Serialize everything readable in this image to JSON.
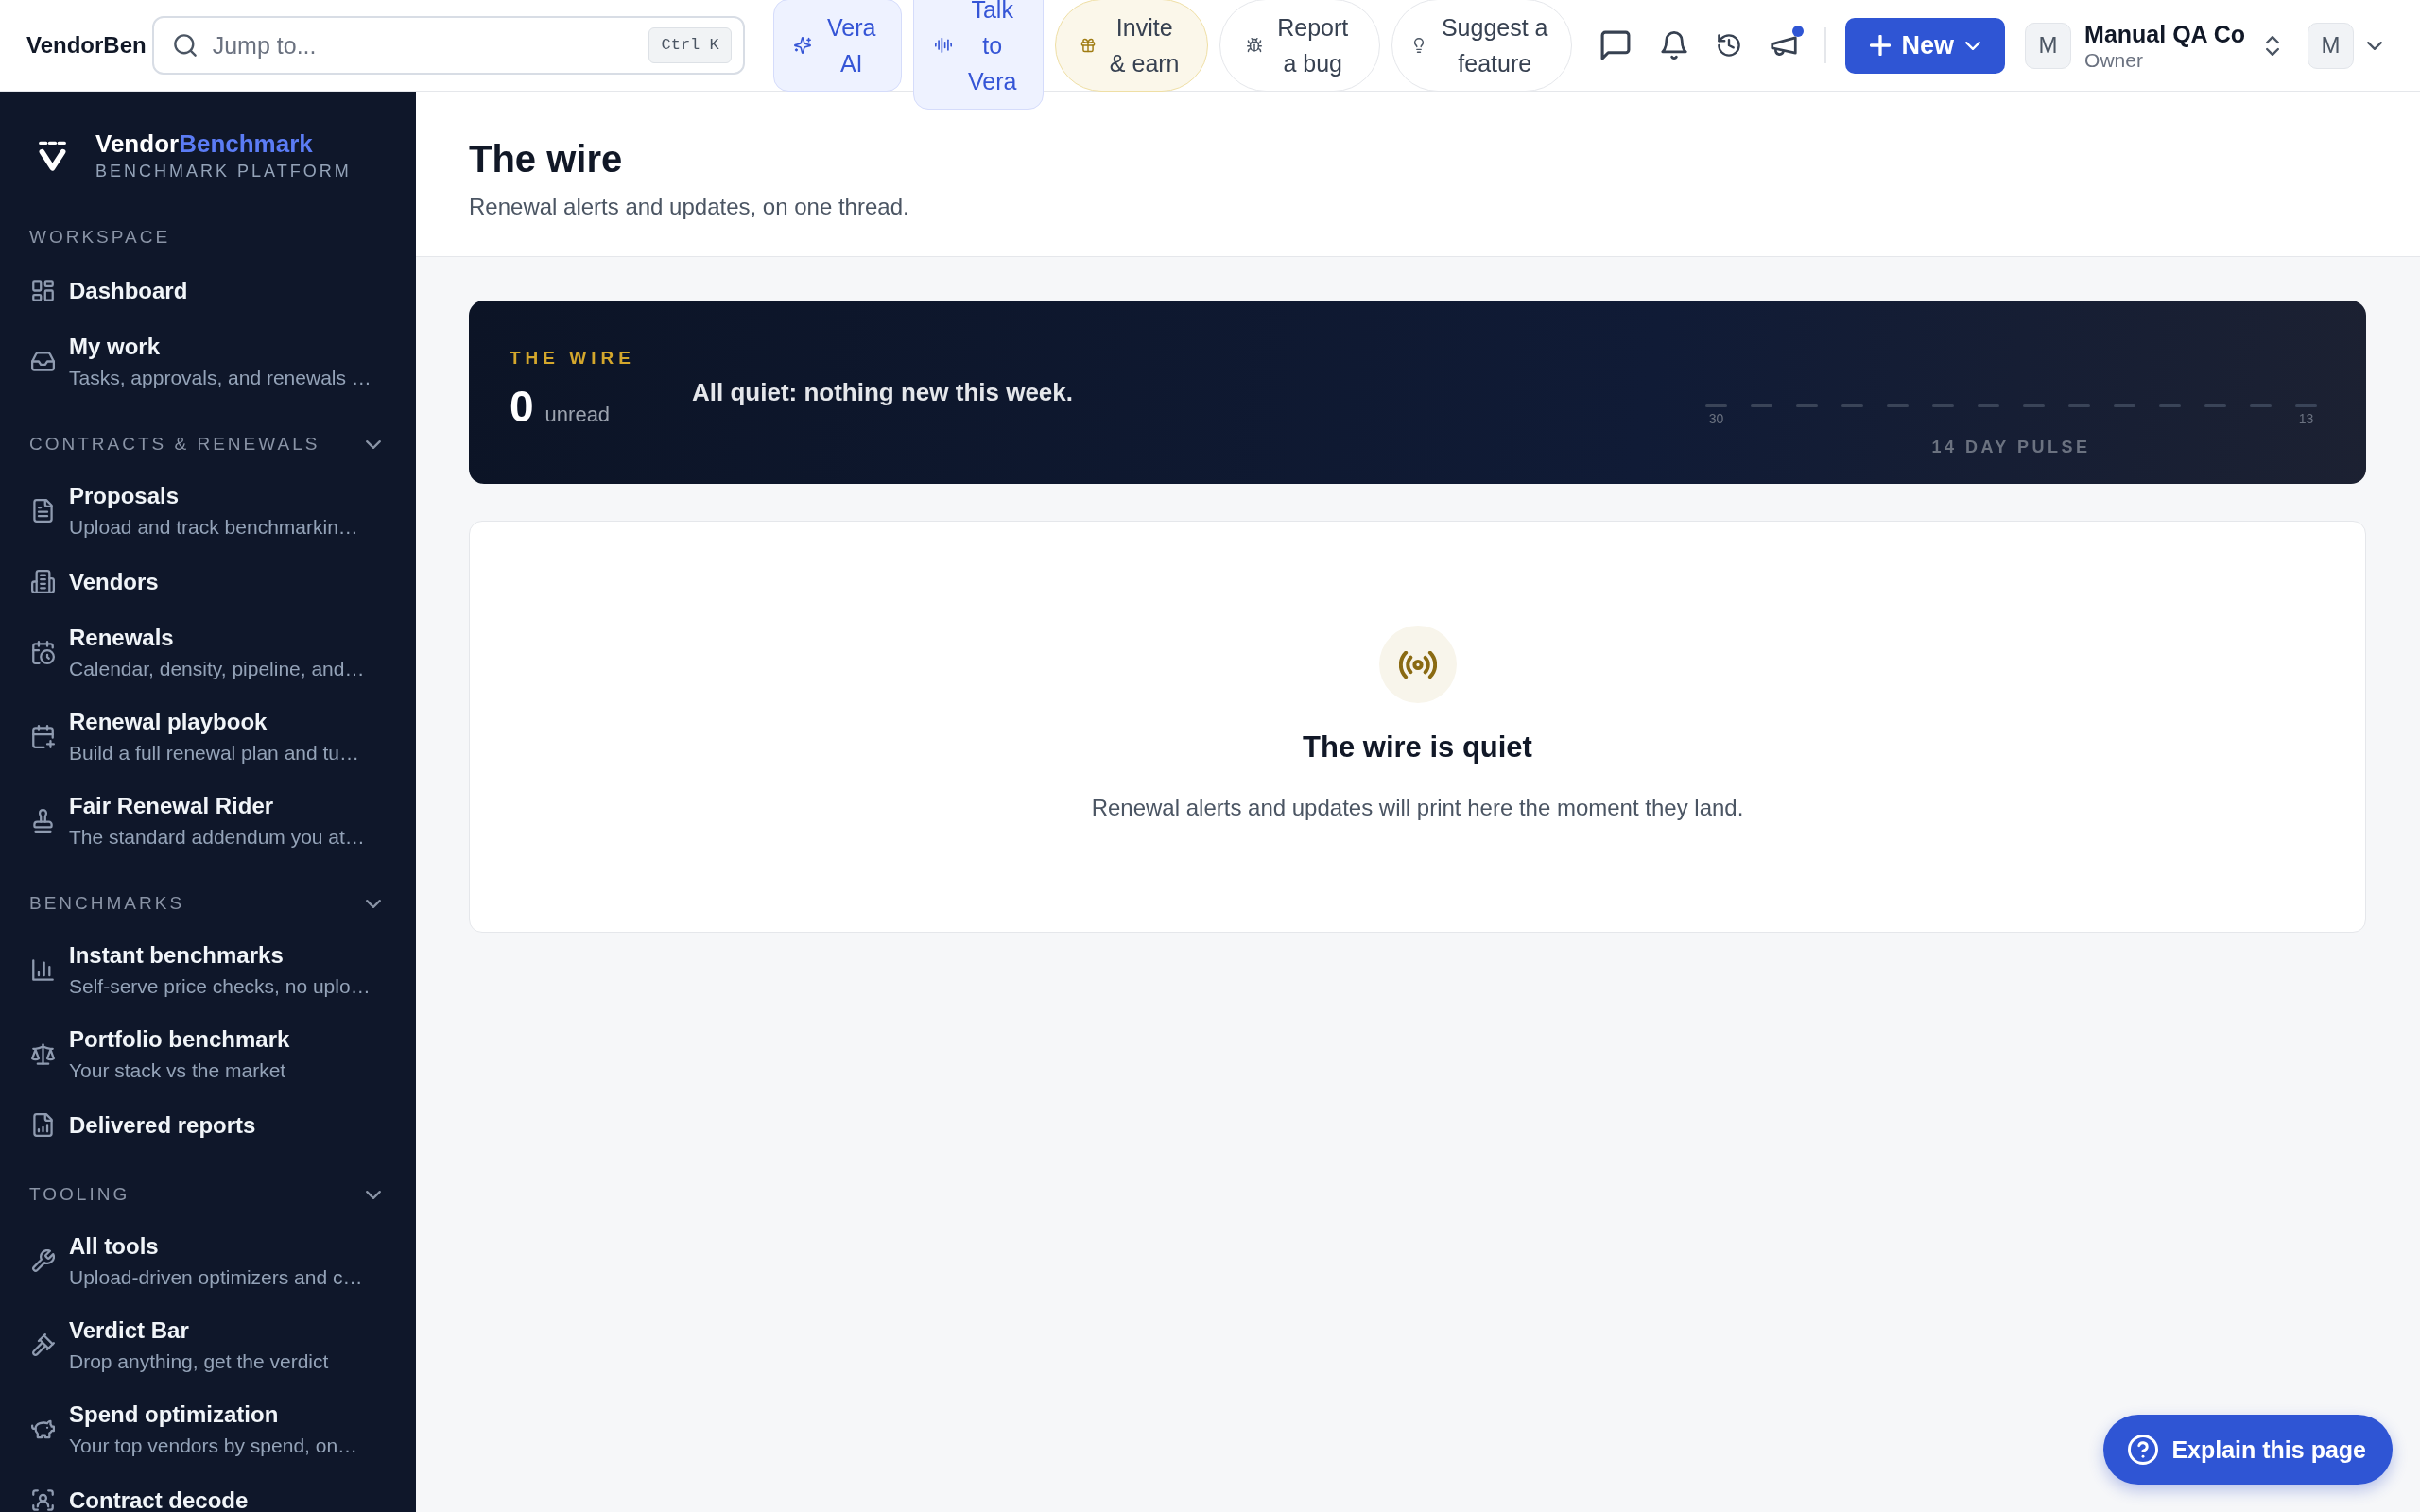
{
  "topbar": {
    "brand": "VendorBen",
    "search": {
      "placeholder": "Jump to...",
      "shortcut": "Ctrl K"
    },
    "actions": [
      {
        "kind": "assistant",
        "label": "Vera AI"
      },
      {
        "kind": "voice",
        "label": "Talk to Vera"
      },
      {
        "kind": "invite",
        "label": "Invite & earn"
      },
      {
        "kind": "bug",
        "label": "Report a bug"
      },
      {
        "kind": "idea",
        "label": "Suggest a feature"
      }
    ],
    "icon_buttons": [
      {
        "kind": "chat",
        "badge": false
      },
      {
        "kind": "notifications",
        "badge": false
      },
      {
        "kind": "history",
        "badge": false
      },
      {
        "kind": "announcements",
        "badge": true
      }
    ],
    "new_button": {
      "label": "New"
    },
    "workspace": {
      "avatar": "M",
      "name": "Manual QA Co",
      "role": "Owner"
    },
    "user": {
      "avatar": "M"
    }
  },
  "sidebar": {
    "brand": {
      "name": "Vendor",
      "name_highlight": "Benchmark",
      "tagline": "BENCHMARK PLATFORM"
    },
    "sections": [
      {
        "title": "WORKSPACE",
        "collapsible": false,
        "items": [
          {
            "kind": "dashboard",
            "label": "Dashboard",
            "selected": false
          },
          {
            "kind": "inbox",
            "label": "My work",
            "description": "Tasks, approvals, and renewals …",
            "selected": false
          }
        ]
      },
      {
        "title": "CONTRACTS & RENEWALS",
        "collapsible": true,
        "expanded": true,
        "items": [
          {
            "kind": "document",
            "label": "Proposals",
            "description": "Upload and track benchmarkin…",
            "selected": false
          },
          {
            "kind": "building",
            "label": "Vendors",
            "selected": false
          },
          {
            "kind": "schedule",
            "label": "Renewals",
            "description": "Calendar, density, pipeline, and…",
            "selected": false
          },
          {
            "kind": "planner",
            "label": "Renewal playbook",
            "description": "Build a full renewal plan and tu…",
            "selected": false
          },
          {
            "kind": "stamp",
            "label": "Fair Renewal Rider",
            "description": "The standard addendum you at…",
            "selected": false
          }
        ]
      },
      {
        "title": "BENCHMARKS",
        "collapsible": true,
        "expanded": true,
        "items": [
          {
            "kind": "chart",
            "label": "Instant benchmarks",
            "description": "Self-serve price checks, no uplo…",
            "selected": false
          },
          {
            "kind": "scales",
            "label": "Portfolio benchmark",
            "description": "Your stack vs the market",
            "selected": false
          },
          {
            "kind": "report",
            "label": "Delivered reports",
            "selected": false
          }
        ]
      },
      {
        "title": "TOOLING",
        "collapsible": true,
        "expanded": true,
        "items": [
          {
            "kind": "wrench",
            "label": "All tools",
            "description": "Upload-driven optimizers and c…",
            "selected": false
          },
          {
            "kind": "gavel",
            "label": "Verdict Bar",
            "description": "Drop anything, get the verdict",
            "selected": false
          },
          {
            "kind": "savings",
            "label": "Spend optimization",
            "description": "Your top vendors by spend, on…",
            "selected": false
          },
          {
            "kind": "scan",
            "label": "Contract decode",
            "selected": false
          }
        ]
      }
    ]
  },
  "page": {
    "title": "The wire",
    "subtitle": "Renewal alerts and updates, on one thread."
  },
  "wire_summary": {
    "eyebrow": "THE WIRE",
    "unread_count": "0",
    "unread_label": "unread",
    "message": "All quiet: nothing new this week.",
    "pulse": {
      "start_label": "30",
      "end_label": "13",
      "title": "14 DAY PULSE"
    }
  },
  "empty_state": {
    "title": "The wire is quiet",
    "message": "Renewal alerts and updates will print here the moment they land."
  },
  "help_button": {
    "label": "Explain this page"
  }
}
